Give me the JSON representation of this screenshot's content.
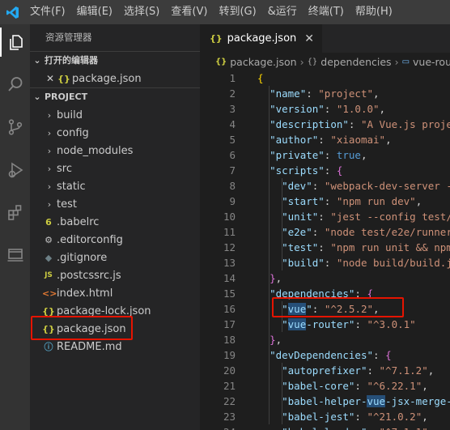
{
  "menu": [
    "文件(F)",
    "编辑(E)",
    "选择(S)",
    "查看(V)",
    "转到(G)",
    "&运行",
    "终端(T)",
    "帮助(H)"
  ],
  "sidebar": {
    "title": "资源管理器",
    "open_editors_label": "打开的编辑器",
    "open_editor_file": "package.json",
    "project_label": "PROJECT",
    "folders": [
      "build",
      "config",
      "node_modules",
      "src",
      "static",
      "test"
    ],
    "files": [
      {
        "name": ".babelrc",
        "icon": "6",
        "color": "#cbcb41"
      },
      {
        "name": ".editorconfig",
        "icon": "⚙",
        "color": "#c5c5c5"
      },
      {
        "name": ".gitignore",
        "icon": "◆",
        "color": "#6d8086"
      },
      {
        "name": ".postcssrc.js",
        "icon": "JS",
        "color": "#cbcb41"
      },
      {
        "name": "index.html",
        "icon": "<>",
        "color": "#e37933"
      },
      {
        "name": "package-lock.json",
        "icon": "{}",
        "color": "#cbcb41"
      },
      {
        "name": "package.json",
        "icon": "{}",
        "color": "#cbcb41"
      },
      {
        "name": "README.md",
        "icon": "ⓘ",
        "color": "#519aba"
      }
    ]
  },
  "editor": {
    "tab_label": "package.json",
    "breadcrumb": [
      "package.json",
      "dependencies",
      "vue-rou"
    ],
    "line_numbers": [
      "1",
      "2",
      "3",
      "4",
      "5",
      "6",
      "7",
      "8",
      "9",
      "10",
      "11",
      "12",
      "13",
      "14",
      "15",
      "16",
      "17",
      "18",
      "19",
      "20",
      "21",
      "22",
      "23",
      "24"
    ]
  },
  "colors": {
    "accent_highlight": "#e51400",
    "json_key": "#9cdcfe",
    "json_string": "#ce9178",
    "json_bool": "#569cd6",
    "json_icon": "#cbcb41"
  }
}
